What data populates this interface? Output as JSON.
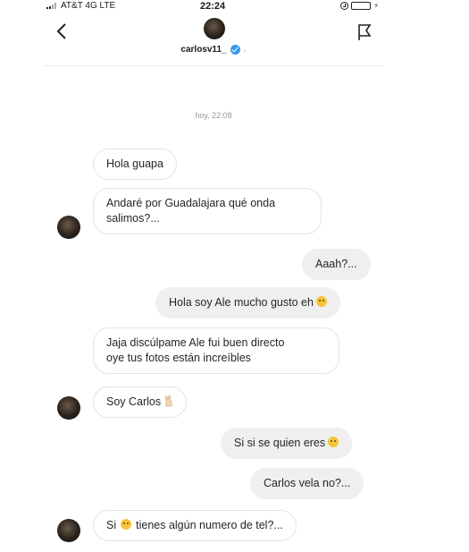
{
  "status_bar": {
    "carrier": "AT&T 4G  LTE",
    "time": "22:24"
  },
  "header": {
    "username": "carlosv11_",
    "icons": [
      "back-arrow-icon",
      "profile-avatar",
      "verified-icon",
      "flag-icon"
    ]
  },
  "chat": {
    "timestamp": "hoy, 22:08",
    "messages": [
      {
        "from": "carlos",
        "lines": [
          "Hola guapa"
        ]
      },
      {
        "from": "carlos",
        "lines": [
          "Andaré por Guadalajara qué onda",
          "salimos?..."
        ]
      },
      {
        "from": "me",
        "lines": [
          "Aaah?..."
        ]
      },
      {
        "from": "me",
        "lines": [
          "Hola soy Ale mucho gusto eh"
        ],
        "emoji": "smile-emoji"
      },
      {
        "from": "carlos",
        "lines": [
          "Jaja discúlpame Ale fui buen directo",
          "oye tus fotos están increíbles"
        ]
      },
      {
        "from": "carlos",
        "lines": [
          "Soy Carlos"
        ],
        "emoji": "victory-hand-emoji"
      },
      {
        "from": "me",
        "lines": [
          "Si si se quien eres"
        ],
        "emoji": "grin-emoji"
      },
      {
        "from": "me",
        "lines": [
          "Carlos vela no?..."
        ]
      },
      {
        "from": "carlos",
        "lines": [
          "Si",
          "tienes algún numero de tel?..."
        ],
        "emoji": "smile-emoji"
      }
    ]
  }
}
